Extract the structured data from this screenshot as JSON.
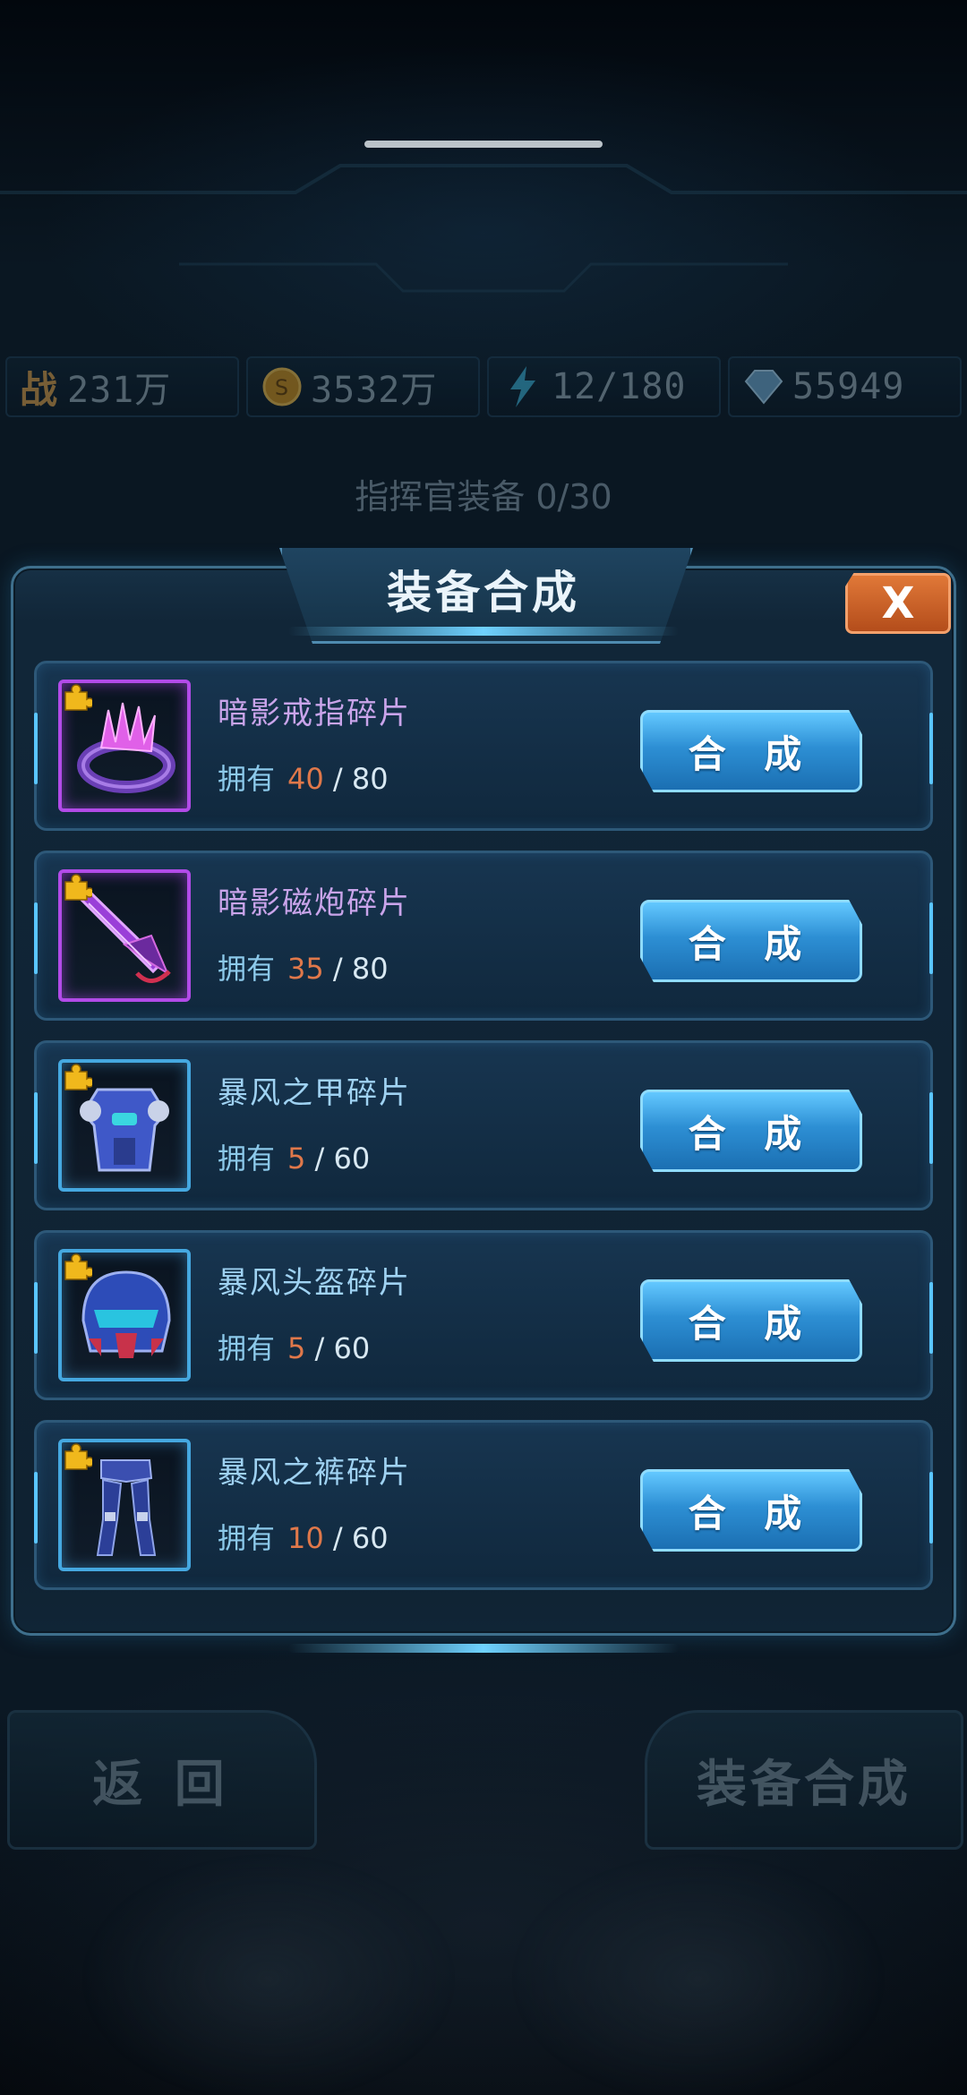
{
  "stats": {
    "power_label": "战",
    "power": "231万",
    "gold": "3532万",
    "energy": "12/180",
    "diamonds": "55949"
  },
  "background": {
    "subtitle": "指挥官装备 0/30",
    "back_label": "返 回",
    "synth_label": "装备合成"
  },
  "dialog": {
    "title": "装备合成",
    "close_label": "X",
    "owned_label": "拥有",
    "separator": "/",
    "items": [
      {
        "name": "暗影戒指碎片",
        "owned": "40",
        "required": "80",
        "button": "合 成",
        "rarity": "purple",
        "icon": "ring-icon"
      },
      {
        "name": "暗影磁炮碎片",
        "owned": "35",
        "required": "80",
        "button": "合 成",
        "rarity": "purple",
        "icon": "cannon-icon"
      },
      {
        "name": "暴风之甲碎片",
        "owned": "5",
        "required": "60",
        "button": "合 成",
        "rarity": "blue",
        "icon": "armor-icon"
      },
      {
        "name": "暴风头盔碎片",
        "owned": "5",
        "required": "60",
        "button": "合 成",
        "rarity": "blue",
        "icon": "helmet-icon"
      },
      {
        "name": "暴风之裤碎片",
        "owned": "10",
        "required": "60",
        "button": "合 成",
        "rarity": "blue",
        "icon": "legs-icon"
      }
    ]
  },
  "colors": {
    "purple_rarity": "#b24be8",
    "blue_rarity": "#45a8e0",
    "owned_count": "#e0784a",
    "close_button": "#d0642a",
    "synth_button": "#2d8fd4"
  }
}
